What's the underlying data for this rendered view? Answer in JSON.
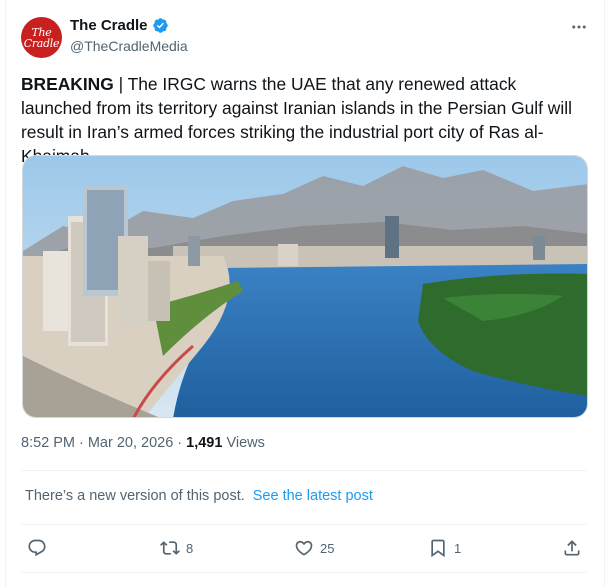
{
  "account": {
    "avatar_text": "The Cradle",
    "display_name": "The Cradle",
    "handle": "@TheCradleMedia"
  },
  "post": {
    "lead": "BREAKING",
    "body": " | The IRGC warns the UAE that any renewed attack launched from its territory against Iranian islands in the Persian Gulf will result in Iran’s armed forces striking the industrial port city of Ras al-Khaimah.",
    "time": "8:52 PM",
    "sep1": "·",
    "date": "Mar 20, 2026",
    "sep2": "·",
    "views_count": "1,491",
    "views_label": "Views"
  },
  "notice": {
    "text": "There’s a new version of this post.",
    "link": "See the latest post"
  },
  "actions": {
    "reply_count": "",
    "repost_count": "8",
    "like_count": "25",
    "bookmark_count": "1"
  },
  "icons": {
    "verified": "verified-badge-icon",
    "more": "more-icon",
    "reply": "reply-icon",
    "repost": "repost-icon",
    "like": "heart-icon",
    "bookmark": "bookmark-icon",
    "share": "share-icon"
  },
  "colors": {
    "brand_red": "#c8201e",
    "accent_blue": "#1d9bf0",
    "secondary_text": "#536471",
    "primary_text": "#0f1419"
  }
}
